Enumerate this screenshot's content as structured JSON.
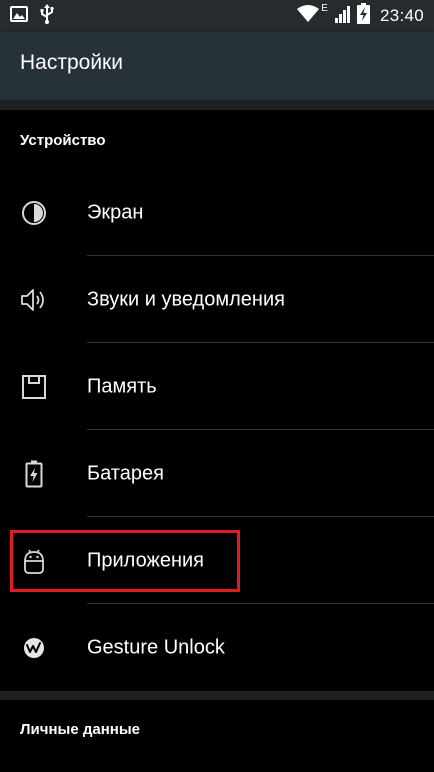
{
  "status_bar": {
    "time": "23:40",
    "network_type": "E",
    "icons": [
      "image-icon",
      "usb-icon",
      "wifi-icon",
      "signal-icon",
      "battery-charging-icon"
    ]
  },
  "action_bar": {
    "title": "Настройки"
  },
  "sections": [
    {
      "header": "Устройство",
      "items": [
        {
          "label": "Экран",
          "icon": "display-icon"
        },
        {
          "label": "Звуки и уведомления",
          "icon": "speaker-icon"
        },
        {
          "label": "Память",
          "icon": "storage-icon"
        },
        {
          "label": "Батарея",
          "icon": "battery-icon"
        },
        {
          "label": "Приложения",
          "icon": "android-icon"
        },
        {
          "label": "Gesture Unlock",
          "icon": "gesture-icon"
        }
      ]
    },
    {
      "header": "Личные данные",
      "items": []
    }
  ],
  "colors": {
    "background": "#000000",
    "action_bar": "#263238",
    "status_bar": "#262b2e",
    "highlight_box": "#e11b22",
    "text": "#ffffff",
    "divider": "#303437"
  }
}
